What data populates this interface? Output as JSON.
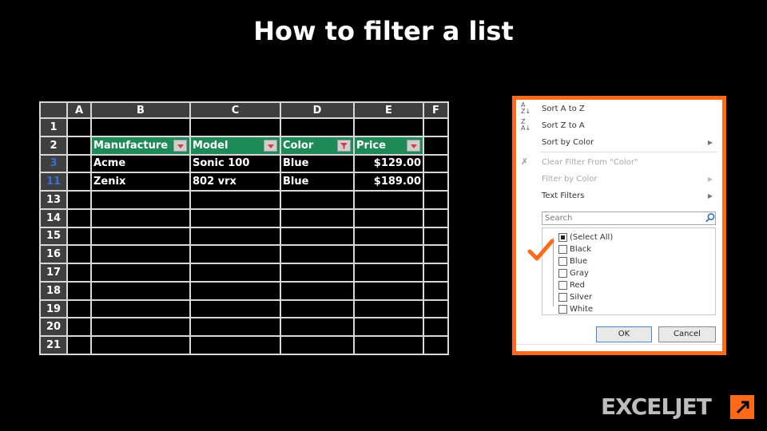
{
  "title": "How to filter a list",
  "sheet": {
    "corner": "",
    "columns": [
      "A",
      "B",
      "C",
      "D",
      "E",
      "F"
    ],
    "rows": [
      {
        "num": "1",
        "filtered": false,
        "cells": [
          "",
          "",
          "",
          "",
          "",
          ""
        ]
      },
      {
        "num": "2",
        "filtered": false,
        "header": true,
        "cells": [
          "",
          "Manufacture",
          "Model",
          "Color",
          "Price",
          ""
        ]
      },
      {
        "num": "3",
        "filtered": true,
        "cells": [
          "",
          "Acme",
          "Sonic 100",
          "Blue",
          "$129.00",
          ""
        ]
      },
      {
        "num": "11",
        "filtered": true,
        "cells": [
          "",
          "Zenix",
          "802 vrx",
          "Blue",
          "$189.00",
          ""
        ]
      },
      {
        "num": "13",
        "filtered": false,
        "cells": [
          "",
          "",
          "",
          "",
          "",
          ""
        ]
      },
      {
        "num": "14",
        "filtered": false,
        "cells": [
          "",
          "",
          "",
          "",
          "",
          ""
        ]
      },
      {
        "num": "15",
        "filtered": false,
        "cells": [
          "",
          "",
          "",
          "",
          "",
          ""
        ]
      },
      {
        "num": "16",
        "filtered": false,
        "cells": [
          "",
          "",
          "",
          "",
          "",
          ""
        ]
      },
      {
        "num": "17",
        "filtered": false,
        "cells": [
          "",
          "",
          "",
          "",
          "",
          ""
        ]
      },
      {
        "num": "18",
        "filtered": false,
        "cells": [
          "",
          "",
          "",
          "",
          "",
          ""
        ]
      },
      {
        "num": "19",
        "filtered": false,
        "cells": [
          "",
          "",
          "",
          "",
          "",
          ""
        ]
      },
      {
        "num": "20",
        "filtered": false,
        "cells": [
          "",
          "",
          "",
          "",
          "",
          ""
        ]
      },
      {
        "num": "21",
        "filtered": false,
        "cells": [
          "",
          "",
          "",
          "",
          "",
          ""
        ]
      }
    ],
    "active_filter_column": "Color",
    "header_fill": "#1e8a57",
    "filtered_row_number_color": "#3a6fd8"
  },
  "menu": {
    "sort_az": "Sort A to Z",
    "sort_za": "Sort Z to A",
    "sort_by_color": "Sort by Color",
    "clear_filter": "Clear Filter From \"Color\"",
    "filter_by_color": "Filter by Color",
    "text_filters": "Text Filters",
    "search_placeholder": "Search",
    "select_all": "(Select All)",
    "options": [
      {
        "label": "Black",
        "checked": false
      },
      {
        "label": "Blue",
        "checked": true
      },
      {
        "label": "Gray",
        "checked": false
      },
      {
        "label": "Red",
        "checked": false
      },
      {
        "label": "Silver",
        "checked": false
      },
      {
        "label": "White",
        "checked": false
      }
    ],
    "ok": "OK",
    "cancel": "Cancel",
    "border_color": "#ff6a1a",
    "check_color": "#ff6a1a"
  },
  "logo": {
    "text": "EXCELJET",
    "color": "#bdbdbd",
    "mark_color": "#ff6a1a"
  }
}
